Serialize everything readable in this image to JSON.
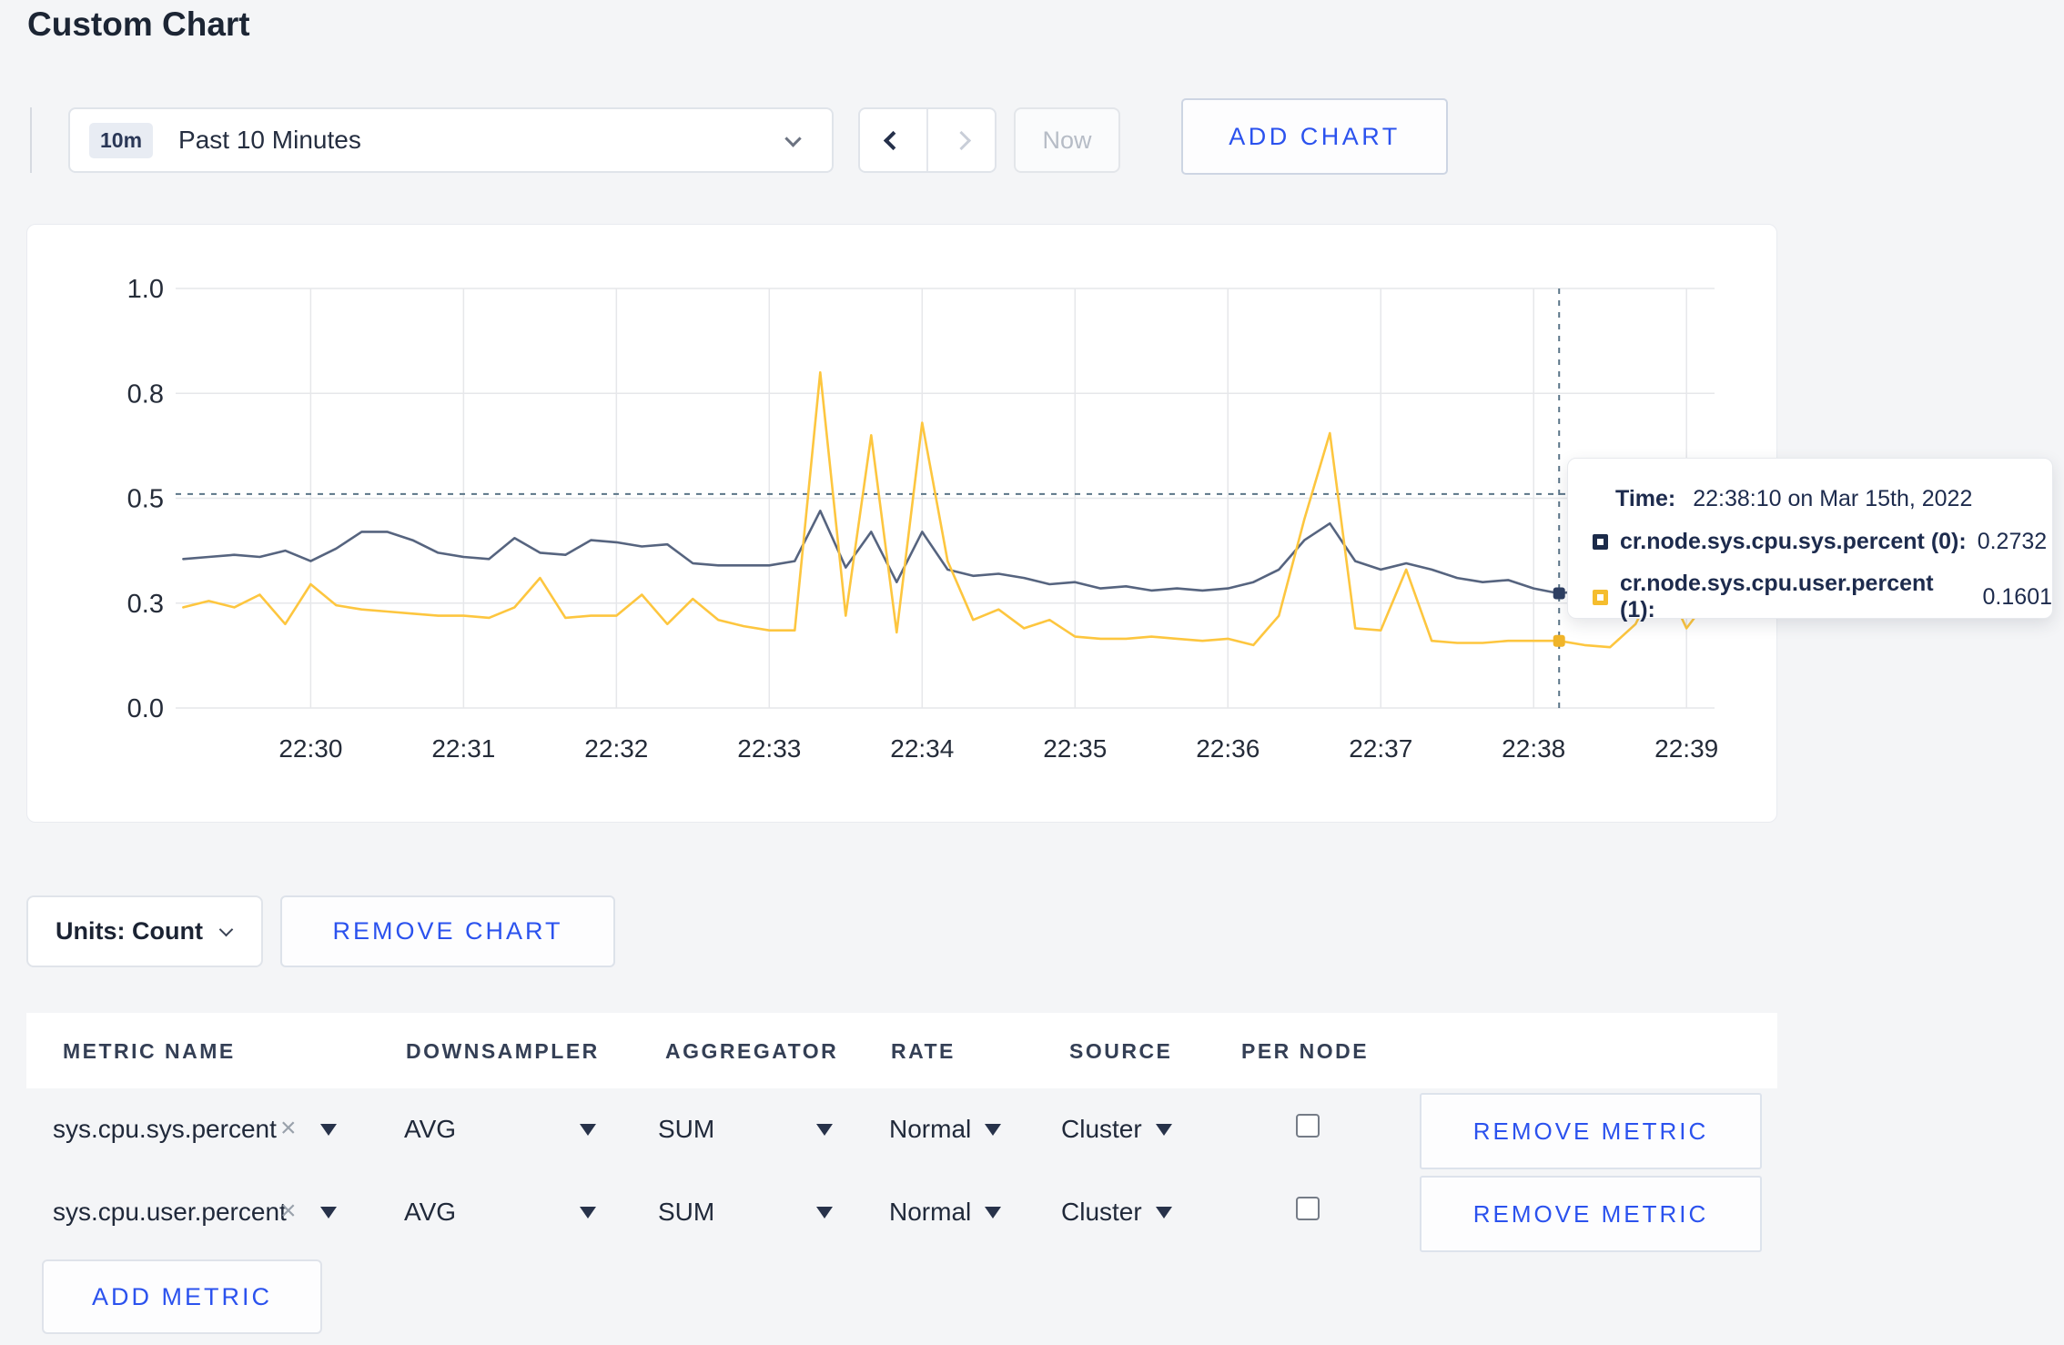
{
  "page": {
    "title": "Custom Chart"
  },
  "toolbar": {
    "time_badge": "10m",
    "time_label": "Past 10 Minutes",
    "now_label": "Now",
    "add_chart_label": "ADD CHART"
  },
  "tooltip": {
    "time_label": "Time:",
    "time_value": "22:38:10 on Mar 15th, 2022",
    "series": [
      {
        "name": "cr.node.sys.cpu.sys.percent (0):",
        "value": "0.2732",
        "color": "#1c2b4a"
      },
      {
        "name": "cr.node.sys.cpu.user.percent (1):",
        "value": "0.1601",
        "color": "#f5bd2e"
      }
    ]
  },
  "units_row": {
    "units_label": "Units: Count",
    "remove_chart_label": "REMOVE CHART"
  },
  "metrics_table": {
    "headers": [
      "METRIC NAME",
      "DOWNSAMPLER",
      "AGGREGATOR",
      "RATE",
      "SOURCE",
      "PER NODE"
    ],
    "rows": [
      {
        "metric": "sys.cpu.sys.percent",
        "close": "×",
        "downsampler": "AVG",
        "aggregator": "SUM",
        "rate": "Normal",
        "source": "Cluster",
        "per_node_checked": false,
        "remove_label": "REMOVE METRIC"
      },
      {
        "metric": "sys.cpu.user.percent",
        "close": "×",
        "downsampler": "AVG",
        "aggregator": "SUM",
        "rate": "Normal",
        "source": "Cluster",
        "per_node_checked": false,
        "remove_label": "REMOVE METRIC"
      }
    ],
    "add_metric_label": "ADD METRIC"
  },
  "chart_data": {
    "type": "line",
    "title": "",
    "xlabel": "",
    "ylabel": "",
    "ylim": [
      0,
      1
    ],
    "grid": true,
    "grid_color": "#e6e7ea",
    "axis_color": "#252c39",
    "crosshair_color": "#5b7588",
    "y_ticks": {
      "labels": [
        "0.0",
        "0.3",
        "0.5",
        "0.8",
        "1.0"
      ],
      "values": [
        0,
        0.25,
        0.5,
        0.75,
        1.0
      ]
    },
    "x_ticks": [
      "22:30",
      "22:31",
      "22:32",
      "22:33",
      "22:34",
      "22:35",
      "22:36",
      "22:37",
      "22:38",
      "22:39"
    ],
    "x_tick_seconds": [
      0,
      60,
      120,
      180,
      240,
      300,
      360,
      420,
      480,
      540
    ],
    "x_min": -53,
    "x_max": 551,
    "x_start_seconds": -50,
    "x_step_seconds": 10,
    "series": [
      {
        "name": "cr.node.sys.cpu.sys.percent (0)",
        "color": "#56647f",
        "values": [
          0.355,
          0.36,
          0.365,
          0.36,
          0.375,
          0.35,
          0.38,
          0.42,
          0.42,
          0.4,
          0.37,
          0.36,
          0.355,
          0.405,
          0.37,
          0.365,
          0.4,
          0.395,
          0.385,
          0.39,
          0.345,
          0.34,
          0.34,
          0.34,
          0.35,
          0.47,
          0.335,
          0.42,
          0.3,
          0.42,
          0.33,
          0.315,
          0.32,
          0.31,
          0.295,
          0.3,
          0.285,
          0.29,
          0.28,
          0.285,
          0.28,
          0.285,
          0.3,
          0.33,
          0.4,
          0.44,
          0.35,
          0.33,
          0.345,
          0.33,
          0.31,
          0.3,
          0.305,
          0.285,
          0.2732,
          0.28,
          0.3,
          0.33,
          0.36,
          0.35,
          0.31
        ]
      },
      {
        "name": "cr.node.sys.cpu.user.percent (1)",
        "color": "#fdc63f",
        "values": [
          0.24,
          0.255,
          0.24,
          0.27,
          0.2,
          0.295,
          0.245,
          0.235,
          0.23,
          0.225,
          0.22,
          0.22,
          0.215,
          0.24,
          0.31,
          0.215,
          0.22,
          0.22,
          0.27,
          0.2,
          0.26,
          0.21,
          0.195,
          0.185,
          0.185,
          0.8,
          0.22,
          0.65,
          0.18,
          0.68,
          0.35,
          0.21,
          0.235,
          0.19,
          0.21,
          0.17,
          0.165,
          0.165,
          0.17,
          0.165,
          0.16,
          0.165,
          0.15,
          0.22,
          0.45,
          0.655,
          0.19,
          0.185,
          0.33,
          0.16,
          0.155,
          0.155,
          0.16,
          0.16,
          0.1601,
          0.15,
          0.145,
          0.2,
          0.32,
          0.19,
          0.27
        ]
      }
    ],
    "crosshair": {
      "x_seconds": 490,
      "h_line_value": 0.51,
      "dots": [
        {
          "series": 0,
          "value": 0.2732,
          "color": "#2e3f63"
        },
        {
          "series": 1,
          "value": 0.1601,
          "color": "#f0b429"
        }
      ]
    },
    "legend_position": "tooltip"
  }
}
